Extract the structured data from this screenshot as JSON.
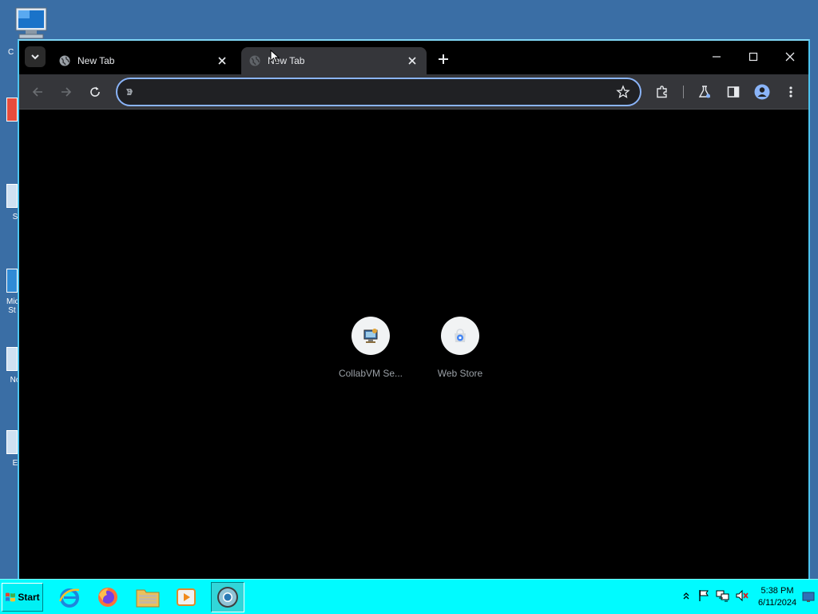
{
  "colors": {
    "desktop": "#3a6ea5",
    "window_border": "#4cc4f0",
    "tabstrip": "#000000",
    "toolbar": "#35363a",
    "omnibox_focus": "#8ab4f8",
    "content": "#000000",
    "taskbar": "#00fbff"
  },
  "desktop": {
    "icons": [
      {
        "label": "C",
        "icon": "computer-icon"
      },
      {
        "label": "",
        "icon": "desktop-shortcut-icon"
      },
      {
        "label": "S",
        "icon": "desktop-shortcut-icon"
      },
      {
        "label": "Micr St",
        "icon": "desktop-shortcut-icon"
      },
      {
        "label": "No",
        "icon": "desktop-shortcut-icon"
      },
      {
        "label": "E",
        "icon": "desktop-shortcut-icon"
      }
    ]
  },
  "browser": {
    "tabs": [
      {
        "title": "New Tab",
        "active": false,
        "favicon": "globe-icon"
      },
      {
        "title": "New Tab",
        "active": true,
        "favicon": "globe-icon"
      }
    ],
    "toolbar": {
      "back_icon": "back-arrow-icon",
      "forward_icon": "forward-arrow-icon",
      "reload_icon": "reload-icon",
      "address_value": "",
      "bookmark_icon": "star-icon",
      "extensions_icon": "puzzle-icon",
      "labs_icon": "flask-icon",
      "side_panel_icon": "side-panel-icon",
      "profile_icon": "profile-icon",
      "menu_icon": "kebab-menu-icon"
    },
    "shortcuts": [
      {
        "name": "CollabVM Se...",
        "icon": "collabvm-icon"
      },
      {
        "name": "Web Store",
        "icon": "web-store-icon"
      }
    ]
  },
  "taskbar": {
    "start_label": "Start",
    "apps": [
      {
        "name": "internet-explorer",
        "icon": "ie-icon"
      },
      {
        "name": "firefox",
        "icon": "firefox-icon"
      },
      {
        "name": "file-explorer",
        "icon": "folder-icon"
      },
      {
        "name": "media-player",
        "icon": "media-player-icon"
      },
      {
        "name": "chrome",
        "icon": "chrome-icon",
        "active": true
      }
    ],
    "tray_icons": [
      "chevron-up-icon",
      "flag-icon",
      "network-icon",
      "volume-muted-icon"
    ],
    "clock": {
      "time": "5:38 PM",
      "date": "6/11/2024"
    }
  }
}
